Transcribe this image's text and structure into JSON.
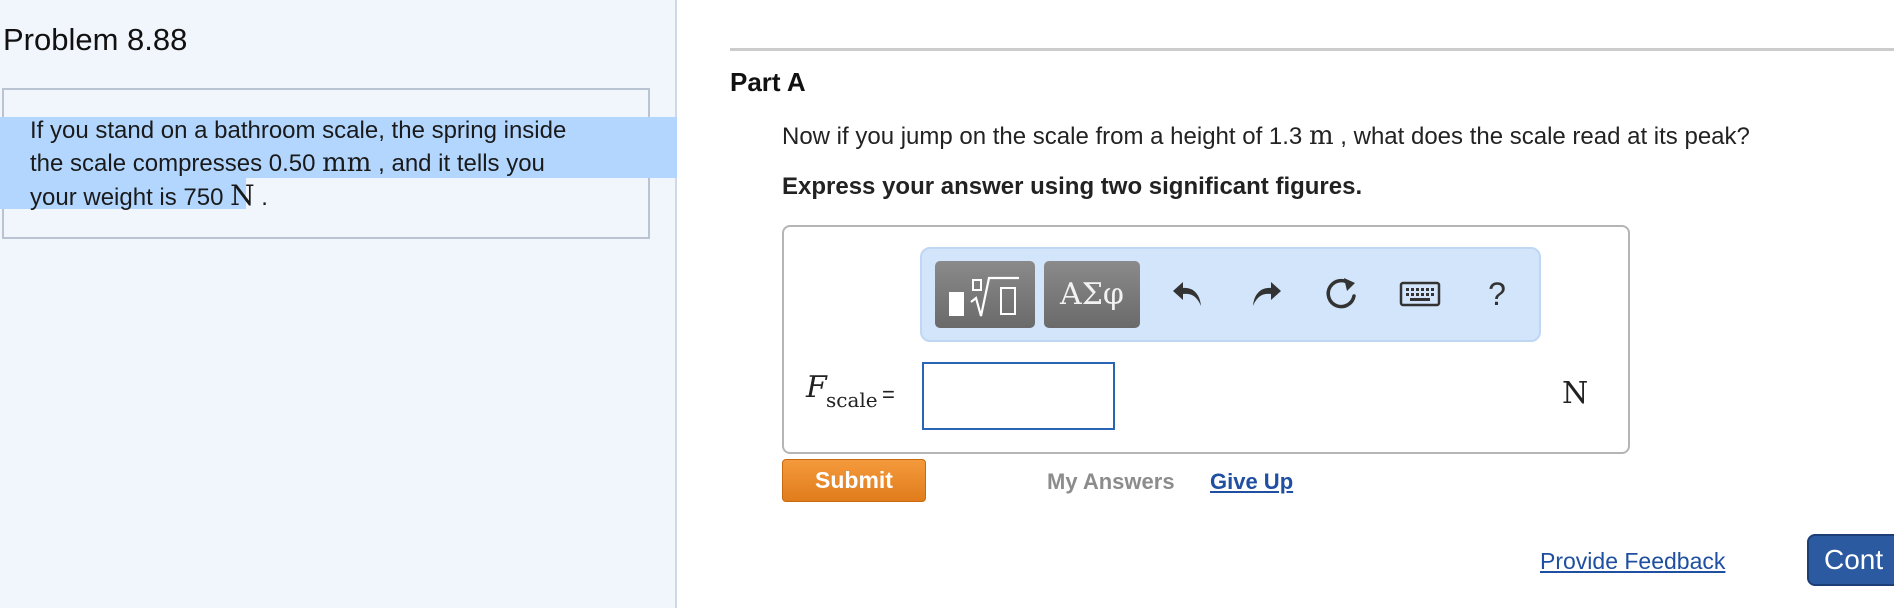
{
  "problem": {
    "title": "Problem 8.88",
    "text_1": "If you stand on a bathroom scale, the spring inside",
    "text_2a": "the scale compresses 0.50 ",
    "unit_mm": "mm",
    "text_2b": " , and it tells you",
    "text_3a": "your weight is 750 ",
    "unit_n": "N",
    "text_3b": " ."
  },
  "part": {
    "title": "Part A",
    "question_a": "Now if you jump on the scale from a height of 1.3 ",
    "question_unit": "m",
    "question_b": " , what does the scale read at its peak?",
    "instruction": "Express your answer using two significant figures."
  },
  "toolbar": {
    "greek_label": "ΑΣφ",
    "help_label": "?"
  },
  "answer": {
    "variable": "F",
    "subscript": "scale",
    "equals": "=",
    "value": "",
    "unit": "N"
  },
  "actions": {
    "submit": "Submit",
    "my_answers": "My Answers",
    "give_up": "Give Up",
    "provide_feedback": "Provide Feedback",
    "continue": "Cont"
  },
  "colors": {
    "left_pane_bg": "#f1f5fc",
    "highlight": "#b3d6ff",
    "submit": "#e88a2c",
    "link": "#1f4fa0",
    "continue": "#2c5aa0"
  }
}
